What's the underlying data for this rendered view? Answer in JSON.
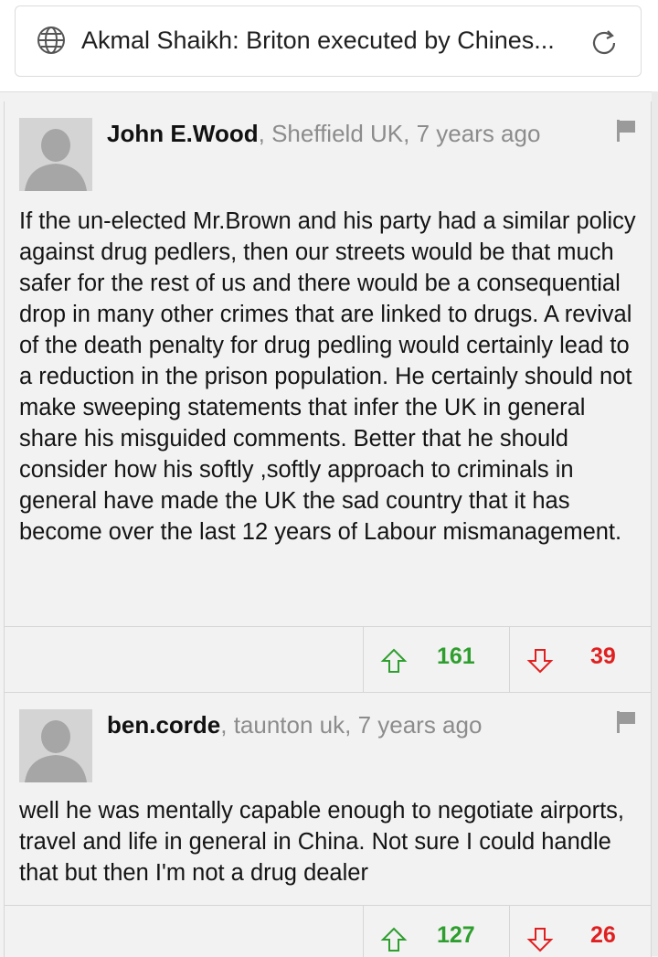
{
  "header": {
    "title": "Akmal Shaikh: Briton executed by Chines...",
    "icons": {
      "site": "globe-icon",
      "refresh": "reload-icon"
    }
  },
  "comments": [
    {
      "author": "John E.Wood",
      "meta": ", Sheffield UK, 7 years ago",
      "text": "If the un-elected Mr.Brown and his party had a similar policy against drug pedlers, then our streets would be that much safer for the rest of us and there would be a consequential drop in many other crimes that are linked to drugs. A revival of the death penalty for drug pedling would certainly lead to a reduction in the prison population. He certainly should not make sweeping statements that infer the UK in general share his misguided comments. Better that he should consider how his softly ,softly approach to criminals in general have made the UK the sad country that it has become over the last 12 years of Labour mismanagement.",
      "upvotes": "161",
      "downvotes": "39"
    },
    {
      "author": "ben.corde",
      "meta": ", taunton uk, 7 years ago",
      "text": "well he was mentally capable enough to negotiate airports, travel and life in general in China. Not sure I could handle that but then I'm not a drug dealer",
      "upvotes": "127",
      "downvotes": "26"
    }
  ],
  "colors": {
    "upvote": "#2e9e2e",
    "downvote": "#e02020",
    "meta": "#8c8c8c",
    "background": "#f2f2f2"
  }
}
